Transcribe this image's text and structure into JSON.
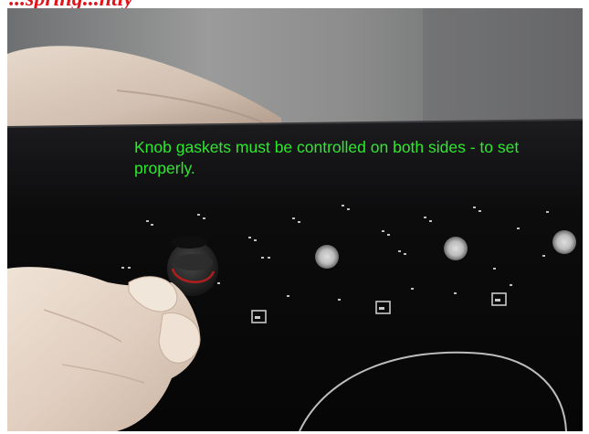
{
  "header": {
    "text": "...spring...ntly"
  },
  "photo": {
    "caption": "Knob gaskets must be controlled on both sides - to set properly.",
    "caption_color": "#2ee82e"
  },
  "colors": {
    "header_red": "#e0141a",
    "glass_black": "#0b0b0c"
  }
}
